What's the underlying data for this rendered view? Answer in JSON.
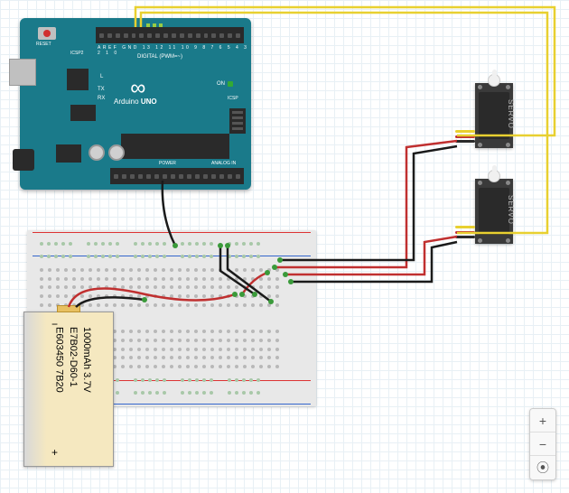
{
  "arduino": {
    "board_name": "Arduino",
    "model": "UNO",
    "reset_label": "RESET",
    "icsp_label": "ICSP2",
    "icsp2_label": "ICSP",
    "digital_label": "DIGITAL (PWM=~)",
    "pin_labels_top": "AREF GND 13 12 11 10 9 8  7 6 5 4 3 2 1 0",
    "on_label": "ON",
    "tx_label": "TX",
    "rx_label": "RX",
    "l_label": "L",
    "power_label": "POWER",
    "analog_label": "ANALOG IN"
  },
  "battery": {
    "line1": "E603450 7B20",
    "line2": "E7B02-D60-1",
    "line3": "1000mAh 3.7V",
    "plus": "+",
    "minus": "−"
  },
  "servo": {
    "label1": "SERVO",
    "label2": "SERVO"
  },
  "wires": {
    "colors": {
      "signal": "#e8d030",
      "power": "#c03030",
      "ground": "#1a1a1a",
      "tip_green": "#3a9a3a"
    }
  },
  "zoom": {
    "in": "+",
    "out": "−",
    "fit": "⦿"
  }
}
